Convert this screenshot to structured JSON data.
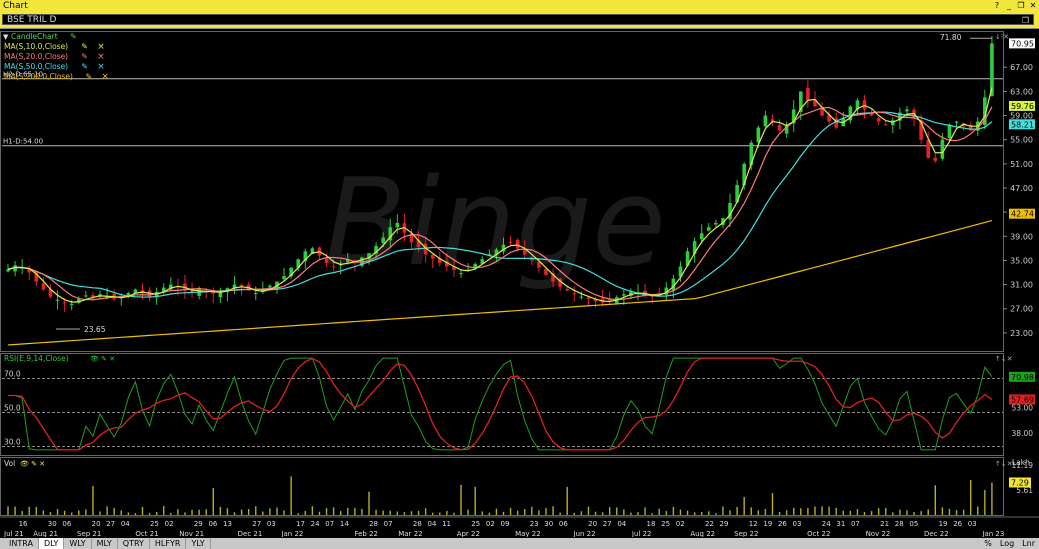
{
  "window": {
    "title": "Chart"
  },
  "symbol": {
    "label": "BSE TRIL D"
  },
  "indicators": [
    {
      "label": "CandleChart",
      "color": "#5ad15a"
    },
    {
      "label": "MA(S,10.0,Close)",
      "color": "#d8f040"
    },
    {
      "label": "MA(S,20.0,Close)",
      "color": "#ff7a7a"
    },
    {
      "label": "MA(S,50.0,Close)",
      "color": "#40e0e0"
    },
    {
      "label": "MA(S,200.0,Close)",
      "color": "#f0c000"
    }
  ],
  "hlines": [
    {
      "label": "H2-D:65.10",
      "value": 65.1
    },
    {
      "label": "H1-D:54.00",
      "value": 54.0
    }
  ],
  "annotations": {
    "high_label": "71.80",
    "low_label": "23.65"
  },
  "price_axis": {
    "ticks": [
      "67.00",
      "63.00",
      "59.00",
      "55.00",
      "51.00",
      "47.00",
      "43.00",
      "39.00",
      "35.00",
      "31.00",
      "27.00",
      "23.00"
    ],
    "tags": [
      {
        "label": "70.95",
        "value": 70.95,
        "bg": "#ffffff",
        "fg": "#000000"
      },
      {
        "label": "59.76",
        "value": 59.76,
        "bg": "#d8f040",
        "fg": "#000000"
      },
      {
        "label": "58.21",
        "value": 58.21,
        "bg": "#40e0e0",
        "fg": "#000000"
      },
      {
        "label": "42.74",
        "value": 42.74,
        "bg": "#f0c000",
        "fg": "#000000"
      }
    ]
  },
  "rsi": {
    "label": "RSI(E,9,14,Close)",
    "left_ticks": [
      "70.0",
      "50.0",
      "30.0"
    ],
    "right_ticks": [
      "53.00",
      "38.00"
    ],
    "tags": [
      {
        "label": "70.98",
        "bg": "#1fa01f",
        "fg": "#000000"
      },
      {
        "label": "57.69",
        "bg": "#e02020",
        "fg": "#000000"
      }
    ]
  },
  "volume": {
    "label": "Vol",
    "unit": "Lakh",
    "ticks": [
      "11.19",
      "5.61"
    ],
    "tag": {
      "label": "7.29",
      "bg": "#f0e63c",
      "fg": "#000000"
    }
  },
  "date_axis": {
    "labels": [
      "Jul 21",
      "16",
      "Aug 21",
      "30",
      "06",
      "Sep 21",
      "20",
      "27",
      "04",
      "Oct 21",
      "25",
      "02",
      "Nov 21",
      "29",
      "06",
      "13",
      "Dec 21",
      "27",
      "03",
      "Jan 22",
      "17",
      "24",
      "07",
      "14",
      "Feb 22",
      "28",
      "07",
      "Mar 22",
      "28",
      "04",
      "11",
      "Apr 22",
      "25",
      "02",
      "09",
      "May 22",
      "23",
      "30",
      "06",
      "Jun 22",
      "20",
      "27",
      "04",
      "Jul 22",
      "18",
      "25",
      "02",
      "Aug 22",
      "22",
      "29",
      "Sep 22",
      "12",
      "19",
      "26",
      "03",
      "Oct 22",
      "24",
      "31",
      "07",
      "Nov 22",
      "21",
      "28",
      "05",
      "Dec 22",
      "19",
      "26",
      "03",
      "Jan 23"
    ]
  },
  "bottom_tabs": [
    "INTRA",
    "DLY",
    "WLY",
    "MLY",
    "QTRY",
    "HLFYR",
    "YLY"
  ],
  "bottom_right": [
    "%",
    "Log",
    "Lnr"
  ],
  "watermark": "Binge",
  "chart_data": {
    "type": "candlestick",
    "ylim": [
      20,
      73
    ],
    "closes": [
      33.5,
      34.2,
      33.8,
      33.0,
      31.5,
      30.2,
      29.0,
      28.5,
      28.0,
      27.8,
      28.6,
      29.2,
      28.8,
      29.4,
      29.0,
      28.6,
      28.9,
      29.6,
      30.2,
      29.5,
      29.0,
      29.8,
      30.5,
      31.0,
      30.6,
      30.0,
      29.7,
      30.2,
      29.8,
      29.5,
      29.9,
      30.4,
      31.0,
      30.5,
      30.0,
      29.6,
      30.1,
      30.8,
      31.5,
      32.4,
      33.8,
      35.2,
      36.5,
      37.0,
      35.8,
      34.6,
      33.9,
      34.5,
      35.2,
      34.6,
      35.5,
      36.2,
      37.4,
      38.8,
      40.5,
      41.2,
      39.6,
      38.0,
      37.2,
      36.0,
      35.3,
      34.6,
      34.0,
      33.4,
      32.9,
      33.5,
      34.4,
      35.2,
      36.0,
      36.8,
      37.6,
      38.0,
      37.0,
      36.0,
      35.0,
      33.8,
      32.6,
      31.5,
      30.6,
      30.0,
      29.5,
      29.0,
      28.6,
      28.2,
      28.0,
      28.4,
      28.9,
      29.4,
      29.8,
      29.6,
      29.2,
      29.0,
      29.5,
      30.5,
      32.0,
      34.0,
      36.5,
      38.2,
      39.5,
      40.5,
      41.2,
      42.0,
      44.5,
      47.5,
      51.0,
      54.5,
      57.0,
      59.0,
      58.0,
      56.5,
      57.5,
      60.0,
      63.0,
      61.5,
      60.5,
      59.0,
      58.0,
      57.0,
      58.5,
      60.5,
      61.5,
      60.0,
      59.0,
      58.0,
      57.5,
      58.2,
      59.5,
      60.0,
      58.5,
      55.0,
      52.0,
      51.5,
      55.0,
      57.5,
      58.0,
      57.2,
      56.5,
      58.0,
      62.0,
      70.95
    ],
    "ma_labels": [
      "MA10",
      "MA20",
      "MA50",
      "MA200"
    ],
    "current_values": {
      "ma10": 59.76,
      "ma50": 58.21,
      "ma200": 42.74,
      "close": 70.95
    },
    "rsi_current": 70.98,
    "rsi_signal_current": 57.69,
    "volume_current_lakh": 7.29
  }
}
